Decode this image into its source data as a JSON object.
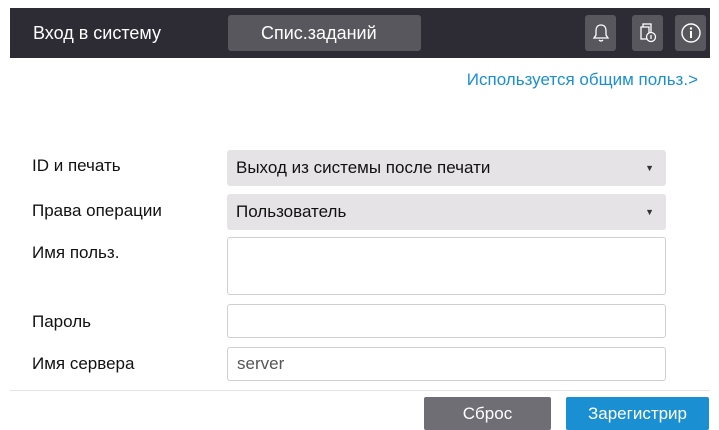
{
  "header": {
    "title": "Вход в систему",
    "job_list_tab": "Спис.заданий",
    "icons": [
      "bell-icon",
      "printer-queue-icon",
      "info-icon"
    ]
  },
  "shared_link": "Используется общим польз.>",
  "form": {
    "id_print": {
      "label": "ID и печать",
      "value": "Выход из системы после печати"
    },
    "permission": {
      "label": "Права операции",
      "value": "Пользователь"
    },
    "username": {
      "label": "Имя польз.",
      "value": ""
    },
    "password": {
      "label": "Пароль",
      "value": ""
    },
    "server": {
      "label": "Имя сервера",
      "value": "server"
    }
  },
  "buttons": {
    "reset": "Сброс",
    "register": "Зарегистрир"
  },
  "colors": {
    "header_bg": "#2d2c34",
    "tab_bg": "#58575e",
    "accent": "#1a8fd2",
    "reset_bg": "#6f6e74",
    "select_bg": "#e6e3e7"
  }
}
